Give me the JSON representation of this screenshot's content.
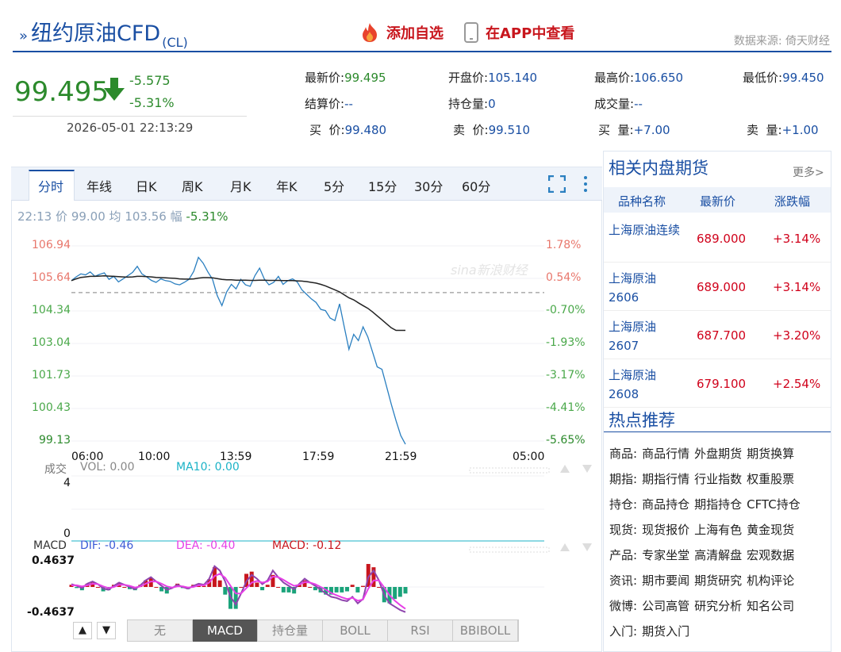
{
  "header": {
    "title": "纽约原油CFD",
    "code": "(CL)",
    "add_watchlist": "添加自选",
    "view_in_app": "在APP中查看",
    "source": "数据来源: 倚天财经",
    "accent_color": "#1a4fa3",
    "red_color": "#c8161d"
  },
  "price": {
    "last": "99.495",
    "change": "-5.575",
    "change_pct": "-5.31%",
    "timestamp": "2026-05-01 22:13:29",
    "direction_icon": "down-arrow-icon"
  },
  "quotes": {
    "latest_label": "最新价:",
    "latest": "99.495",
    "open_label": "开盘价:",
    "open": "105.140",
    "high_label": "最高价:",
    "high": "106.650",
    "low_label": "最低价:",
    "low": "99.450",
    "settle_label": "结算价:",
    "settle": "--",
    "oi_label": "持仓量:",
    "oi": "0",
    "vol_label": "成交量:",
    "vol": "--",
    "bid_label": "买  价:",
    "bid": "99.480",
    "ask_label": "卖  价:",
    "ask": "99.510",
    "bid_size_label": "买  量:",
    "bid_size": "+7.00",
    "ask_size_label": "卖  量:",
    "ask_size": "+1.00"
  },
  "tabs": [
    "分时",
    "年线",
    "日K",
    "周K",
    "月K",
    "年K",
    "5分",
    "15分",
    "30分",
    "60分"
  ],
  "active_tab": "分时",
  "toolbar": {
    "fullscreen_icon": "fullscreen-icon",
    "more_icon": "more-vertical-icon"
  },
  "infoline": {
    "time": "22:13",
    "price_label": "价",
    "price": "99.00",
    "avg_label": "均",
    "avg": "103.56",
    "amp_label": "幅",
    "amp": "-5.31%"
  },
  "watermark": "sina新浪财经",
  "chart_data": [
    {
      "type": "line",
      "title": "分时",
      "x_ticks": [
        "06:00",
        "10:00",
        "13:59",
        "17:59",
        "21:59",
        "05:00"
      ],
      "y_ticks_left": [
        "106.94",
        "105.64",
        "104.34",
        "103.04",
        "101.73",
        "100.43",
        "99.13"
      ],
      "y_ticks_right": [
        "1.78%",
        "0.54%",
        "-0.70%",
        "-1.93%",
        "-3.17%",
        "-4.41%",
        "-5.65%"
      ],
      "ylim": [
        99.13,
        106.94
      ],
      "prev_settle": 105.07,
      "series": [
        {
          "name": "价",
          "color": "#2a7fc0",
          "values": [
            105.55,
            105.7,
            105.82,
            105.78,
            105.9,
            105.72,
            105.8,
            105.86,
            105.6,
            105.72,
            105.5,
            105.62,
            105.75,
            105.88,
            106.12,
            105.82,
            105.7,
            105.56,
            105.48,
            105.62,
            105.55,
            105.52,
            105.42,
            105.38,
            105.48,
            105.6,
            105.92,
            106.48,
            106.25,
            105.9,
            105.6,
            104.95,
            104.55,
            105.1,
            105.4,
            105.22,
            105.6,
            105.38,
            105.32,
            105.75,
            106.05,
            105.62,
            105.38,
            105.48,
            105.72,
            105.4,
            105.55,
            105.62,
            105.5,
            105.18,
            105.0,
            104.82,
            104.68,
            104.4,
            104.35,
            104.05,
            103.95,
            104.62,
            103.7,
            102.8,
            103.4,
            103.15,
            103.7,
            103.3,
            102.7,
            102.1,
            102.0,
            101.3,
            100.6,
            99.95,
            99.35,
            99.0
          ]
        },
        {
          "name": "均",
          "color": "#222222",
          "values": [
            105.55,
            105.62,
            105.68,
            105.7,
            105.72,
            105.72,
            105.73,
            105.74,
            105.73,
            105.72,
            105.71,
            105.7,
            105.69,
            105.7,
            105.72,
            105.72,
            105.71,
            105.7,
            105.68,
            105.67,
            105.66,
            105.65,
            105.64,
            105.62,
            105.61,
            105.61,
            105.62,
            105.65,
            105.67,
            105.67,
            105.66,
            105.63,
            105.6,
            105.58,
            105.58,
            105.57,
            105.57,
            105.57,
            105.56,
            105.56,
            105.57,
            105.57,
            105.56,
            105.56,
            105.56,
            105.55,
            105.55,
            105.55,
            105.54,
            105.53,
            105.51,
            105.48,
            105.45,
            105.4,
            105.34,
            105.26,
            105.18,
            105.1,
            104.98,
            104.86,
            104.78,
            104.66,
            104.55,
            104.44,
            104.3,
            104.14,
            103.98,
            103.82,
            103.66,
            103.56,
            103.56,
            103.56
          ]
        }
      ]
    },
    {
      "type": "bar",
      "title": "成交",
      "legend": [
        "VOL: 0.00",
        "MA10: 0.00"
      ],
      "y_ticks": [
        "4",
        "0"
      ],
      "ylim": [
        0,
        4
      ],
      "values": []
    },
    {
      "type": "bar",
      "title": "MACD",
      "legend": [
        "DIF: -0.46",
        "DEA: -0.40",
        "MACD: -0.12"
      ],
      "y_ticks": [
        "0.4637",
        "-0.4637"
      ],
      "ylim": [
        -0.4637,
        0.4637
      ],
      "series": [
        {
          "name": "DIF",
          "color": "#8e44ad",
          "values": [
            0.05,
            0.02,
            -0.02,
            0.06,
            0.1,
            0.05,
            -0.03,
            -0.05,
            0.02,
            0.08,
            0.04,
            0.0,
            -0.04,
            0.03,
            0.12,
            0.18,
            0.1,
            0.02,
            -0.05,
            -0.02,
            0.04,
            0.0,
            -0.03,
            0.02,
            0.06,
            0.04,
            0.15,
            0.38,
            0.3,
            0.1,
            -0.18,
            -0.32,
            -0.12,
            0.1,
            0.22,
            0.15,
            0.05,
            0.12,
            0.3,
            0.18,
            0.08,
            0.02,
            -0.04,
            0.06,
            0.15,
            0.08,
            0.02,
            -0.05,
            -0.12,
            -0.18,
            -0.2,
            -0.24,
            -0.26,
            -0.18,
            -0.3,
            -0.22,
            0.18,
            0.3,
            0.12,
            -0.15,
            -0.3,
            -0.36,
            -0.42,
            -0.46
          ]
        },
        {
          "name": "DEA",
          "color": "#e640e6",
          "values": [
            0.03,
            0.03,
            0.01,
            0.03,
            0.06,
            0.05,
            0.01,
            -0.02,
            0.0,
            0.04,
            0.04,
            0.02,
            -0.01,
            0.01,
            0.06,
            0.1,
            0.1,
            0.06,
            0.01,
            -0.01,
            0.01,
            0.01,
            -0.01,
            0.0,
            0.03,
            0.03,
            0.08,
            0.2,
            0.24,
            0.17,
            0.02,
            -0.12,
            -0.12,
            -0.02,
            0.08,
            0.11,
            0.08,
            0.1,
            0.19,
            0.18,
            0.13,
            0.07,
            0.02,
            0.04,
            0.09,
            0.08,
            0.05,
            0.0,
            -0.05,
            -0.11,
            -0.15,
            -0.19,
            -0.22,
            -0.2,
            -0.25,
            -0.23,
            -0.03,
            0.12,
            0.12,
            -0.01,
            -0.15,
            -0.25,
            -0.33,
            -0.4
          ]
        }
      ]
    }
  ],
  "indicator_buttons": [
    "无",
    "MACD",
    "持仓量",
    "BOLL",
    "RSI",
    "BBIBOLL"
  ],
  "active_indicator": "MACD",
  "side": {
    "title": "相关内盘期货",
    "more": "更多>",
    "headers": [
      "品种名称",
      "最新价",
      "涨跌幅"
    ],
    "rows": [
      {
        "name": "上海原油连续",
        "price": "689.000",
        "pct": "+3.14%"
      },
      {
        "name": "上海原油2606",
        "price": "689.000",
        "pct": "+3.14%"
      },
      {
        "name": "上海原油2607",
        "price": "687.700",
        "pct": "+3.20%"
      },
      {
        "name": "上海原油2608",
        "price": "679.100",
        "pct": "+2.54%"
      }
    ]
  },
  "hot": {
    "title": "热点推荐",
    "rows": [
      {
        "label": "商品:",
        "items": [
          "商品行情",
          "外盘期货",
          "期货换算"
        ]
      },
      {
        "label": "期指:",
        "items": [
          "期指行情",
          "行业指数",
          "权重股票"
        ]
      },
      {
        "label": "持仓:",
        "items": [
          "商品持仓",
          "期指持仓",
          "CFTC持仓"
        ]
      },
      {
        "label": "现货:",
        "items": [
          "现货报价",
          "上海有色",
          "黄金现货"
        ]
      },
      {
        "label": "产品:",
        "items": [
          "专家坐堂",
          "高清解盘",
          "宏观数据"
        ]
      },
      {
        "label": "资讯:",
        "items": [
          "期市要闻",
          "期货研究",
          "机构评论"
        ]
      },
      {
        "label": "微博:",
        "items": [
          "公司高管",
          "研究分析",
          "知名公司"
        ]
      },
      {
        "label": "入门:",
        "items": [
          "期货入门"
        ]
      }
    ]
  }
}
